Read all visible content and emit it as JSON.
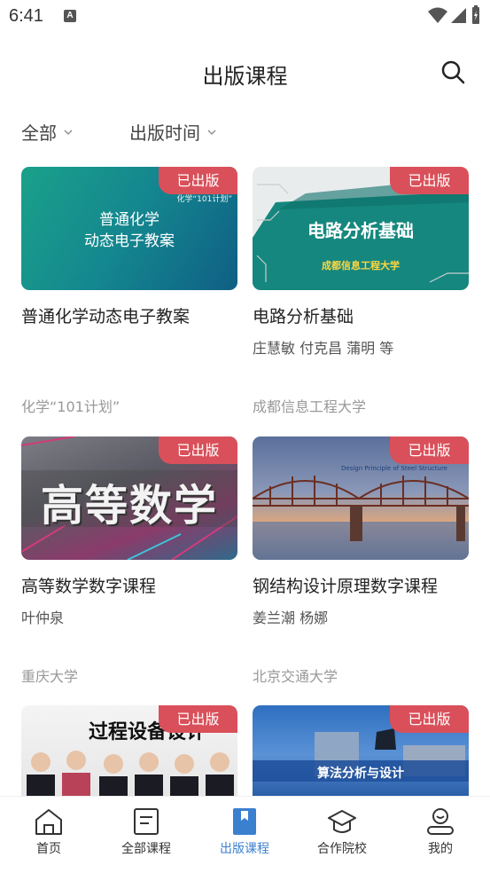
{
  "status": {
    "time": "6:41",
    "notice_glyph": "A"
  },
  "header": {
    "title": "出版课程"
  },
  "filters": [
    {
      "label": "全部"
    },
    {
      "label": "出版时间"
    }
  ],
  "cards": [
    {
      "badge": "已出版",
      "title": "普通化学动态电子教案",
      "author": "",
      "institution": "化学“101计划”",
      "thumb_text": [
        "普通化学",
        "动态电子教案"
      ],
      "thumb_corner": "化学“101计划”"
    },
    {
      "badge": "已出版",
      "title": "电路分析基础",
      "author": "庄慧敏 付克昌 蒲明 等",
      "institution": "成都信息工程大学",
      "thumb_text": [
        "电路分析基础",
        "成都信息工程大学"
      ]
    },
    {
      "badge": "已出版",
      "title": "高等数学数字课程",
      "author": "叶仲泉",
      "institution": "重庆大学",
      "thumb_text": [
        "高等数学"
      ]
    },
    {
      "badge": "已出版",
      "title": "钢结构设计原理数字课程",
      "author": "姜兰潮 杨娜",
      "institution": "北京交通大学",
      "thumb_text": [
        "Design Principle of Steel Structure"
      ]
    },
    {
      "badge": "已出版",
      "title": "",
      "author": "",
      "institution": "",
      "thumb_text": [
        "过程设备设计"
      ]
    },
    {
      "badge": "已出版",
      "title": "",
      "author": "",
      "institution": "",
      "thumb_text": [
        "算法分析与设计"
      ]
    }
  ],
  "tabbar": {
    "tabs": [
      {
        "label": "首页",
        "icon": "home-icon",
        "active": false
      },
      {
        "label": "全部课程",
        "icon": "course-list-icon",
        "active": false
      },
      {
        "label": "出版课程",
        "icon": "bookmark-icon",
        "active": true
      },
      {
        "label": "合作院校",
        "icon": "school-icon",
        "active": false
      },
      {
        "label": "我的",
        "icon": "profile-icon",
        "active": false
      }
    ]
  },
  "colors": {
    "accent": "#3b7fcf",
    "badge": "#d9505a"
  }
}
